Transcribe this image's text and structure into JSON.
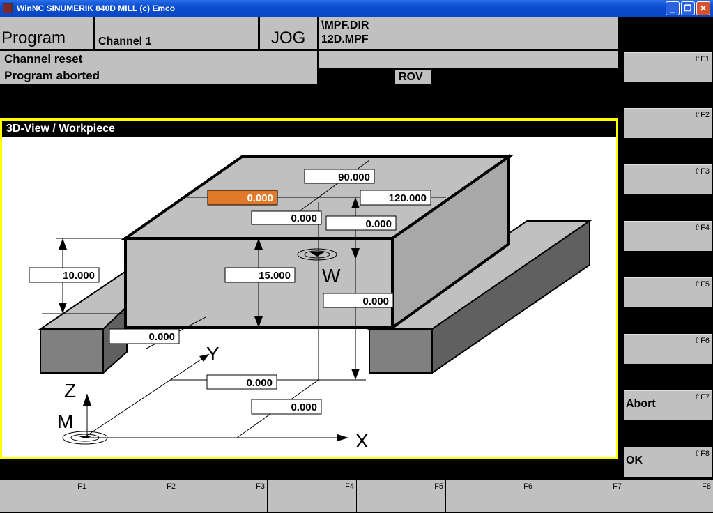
{
  "window": {
    "title": "WinNC SINUMERIK 840D MILL (c) Emco"
  },
  "header": {
    "area": "Program",
    "channel": "Channel 1",
    "mode": "JOG",
    "path_dir": "\\MPF.DIR",
    "path_file": "12D.MPF",
    "status1": "Channel reset",
    "status2": "Program aborted",
    "rov": "ROV"
  },
  "panel": {
    "title": "3D-View / Workpiece"
  },
  "fields": {
    "active": "0.000",
    "length_y": "90.000",
    "length_x": "120.000",
    "offset_y": "0.000",
    "offset_z_top": "0.000",
    "height_left": "10.000",
    "height": "15.000",
    "w_z": "0.000",
    "front": "0.000",
    "w_y": "0.000",
    "w_x": "0.000"
  },
  "axes": {
    "x": "X",
    "y": "Y",
    "z": "Z",
    "m": "M",
    "w": "W"
  },
  "vsoftkeys": [
    {
      "key": "⇧F1",
      "label": ""
    },
    {
      "key": "⇧F2",
      "label": ""
    },
    {
      "key": "⇧F3",
      "label": ""
    },
    {
      "key": "⇧F4",
      "label": ""
    },
    {
      "key": "⇧F5",
      "label": ""
    },
    {
      "key": "⇧F6",
      "label": ""
    },
    {
      "key": "⇧F7",
      "label": "Abort"
    },
    {
      "key": "⇧F8",
      "label": "OK"
    }
  ],
  "hsoftkeys": [
    "F1",
    "F2",
    "F3",
    "F4",
    "F5",
    "F6",
    "F7",
    "F8"
  ],
  "colors": {
    "active_field": "#e07a2a",
    "panel_border": "#ffff00",
    "softkey": "#c0c0c0"
  }
}
